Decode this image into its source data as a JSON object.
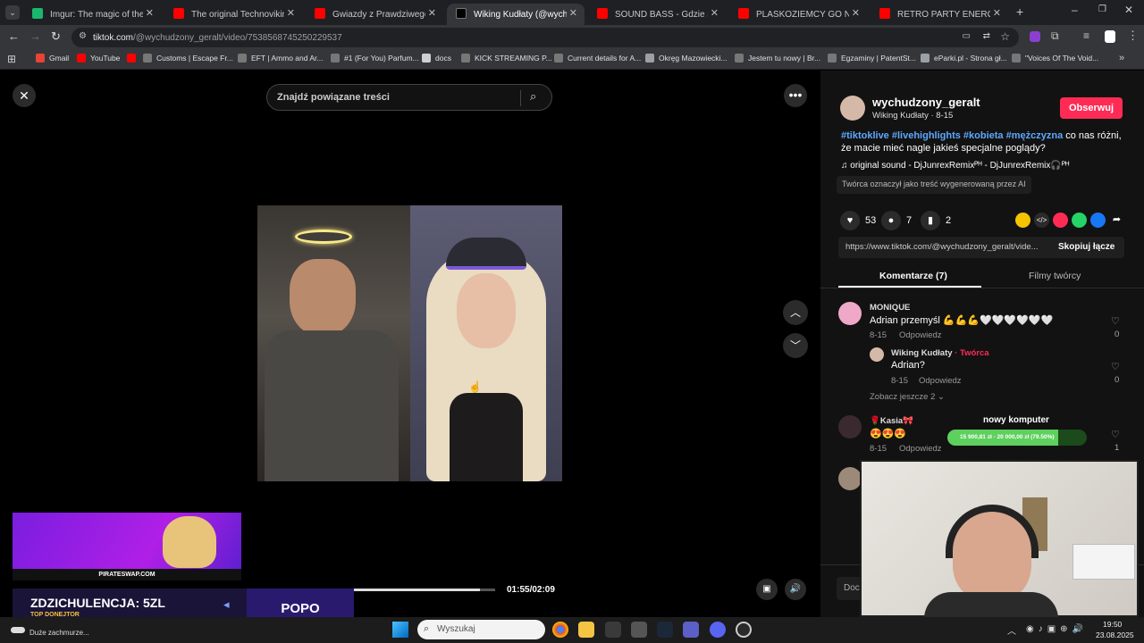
{
  "browser": {
    "tabs": [
      {
        "label": "Imgur: The magic of the Interne",
        "color": "#1bb76e"
      },
      {
        "label": "The original Technoviking video",
        "color": "#ff0000"
      },
      {
        "label": "Gwiazdy z Prawdziwego Lomba",
        "color": "#ff0000"
      },
      {
        "label": "Wiking Kudłaty (@wychudz",
        "color": "#000000"
      },
      {
        "label": "SOUND BASS - Gdzie sie podzi",
        "color": "#ff0000"
      },
      {
        "label": "PLASKOZIEMCY GO NIENAWID",
        "color": "#ff0000"
      },
      {
        "label": "RETRO PARTY ENERGY 2000 PI",
        "color": "#ff0000"
      }
    ],
    "url_host": "tiktok.com",
    "url_path": "/@wychudzony_geralt/video/7538568745250229537",
    "bookmarks": [
      {
        "label": "Gmail",
        "icon": "gmail-icon"
      },
      {
        "label": "YouTube",
        "icon": "youtube-icon"
      },
      {
        "label": "",
        "icon": "youtube-icon"
      },
      {
        "label": "Customs | Escape Fr...",
        "icon": "bookmark-icon"
      },
      {
        "label": "EFT | Ammo and Ar...",
        "icon": "bookmark-icon"
      },
      {
        "label": "#1 (For You) Parfum...",
        "icon": "bookmark-icon"
      },
      {
        "label": "docs",
        "icon": "folder-icon"
      },
      {
        "label": "KICK STREAMING P...",
        "icon": "bookmark-icon"
      },
      {
        "label": "Current details for A...",
        "icon": "bookmark-icon"
      },
      {
        "label": "Okręg Mazowiecki...",
        "icon": "globe-icon"
      },
      {
        "label": "Jestem tu nowy | Br...",
        "icon": "bookmark-icon"
      },
      {
        "label": "Egzaminy | PatentSt...",
        "icon": "bookmark-icon"
      },
      {
        "label": "eParki.pl - Strona gł...",
        "icon": "globe-icon"
      },
      {
        "label": "\"Voices Of The Void...",
        "icon": "bookmark-icon"
      }
    ]
  },
  "video": {
    "search_placeholder": "Znajdź powiązane treści",
    "time": "01:55/02:09",
    "progress": 0.891
  },
  "post": {
    "username": "wychudzony_geralt",
    "display_name": "Wiking Kudłaty · 8-15",
    "follow_label": "Obserwuj",
    "hashtags": "#tiktoklive #livehighlights #kobieta #mężczyzna",
    "caption_rest": " co nas różni, że macie mieć nagle jakieś specjalne poglądy?",
    "sound": "original sound - DjJunrexRemixᴾᴴ - DjJunrexRemix🎧ᴾᴴ",
    "ai_label": "Twórca oznaczył jako treść wygenerowaną przez AI",
    "likes": "53",
    "comments": "7",
    "saves": "2",
    "link": "https://www.tiktok.com/@wychudzony_geralt/vide...",
    "copy_label": "Skopiuj łącze",
    "tab_comments": "Komentarze (7)",
    "tab_videos": "Filmy twórcy"
  },
  "comments": [
    {
      "user": "MONIQUE",
      "text": "Adrian przemyśl 💪💪💪🤍🤍🤍🤍🤍🤍",
      "date": "8-15",
      "reply": "Odpowiedz",
      "likes": "0"
    },
    {
      "user": "Wiking Kudłaty",
      "creator": "· Twórca",
      "text": "Adrian?",
      "date": "8-15",
      "reply": "Odpowiedz",
      "likes": "0"
    },
    {
      "user": "🌹Kasia🎀",
      "text": "😍😍😍",
      "date": "8-15",
      "reply": "Odpowiedz",
      "likes": "1"
    }
  ],
  "more_replies": "Zobacz jeszcze 2",
  "add_comment_stub": "Doc",
  "overlay": {
    "goal_title": "nowy komputer",
    "goal_text": "15 900,81 zł - 20 000,00 zł (79.50%)",
    "goal_progress": 0.795,
    "sponsor": "PIRATESWAP.COM",
    "donor_title": "ZDZICHULENCJA: 5ZL",
    "donor_sub": "TOP DONEJTOR",
    "popo": "POPO",
    "status": "Duże zachmurze..."
  },
  "taskbar": {
    "search": "Wyszukaj",
    "time": "19:50",
    "date": "23.08.2025"
  }
}
